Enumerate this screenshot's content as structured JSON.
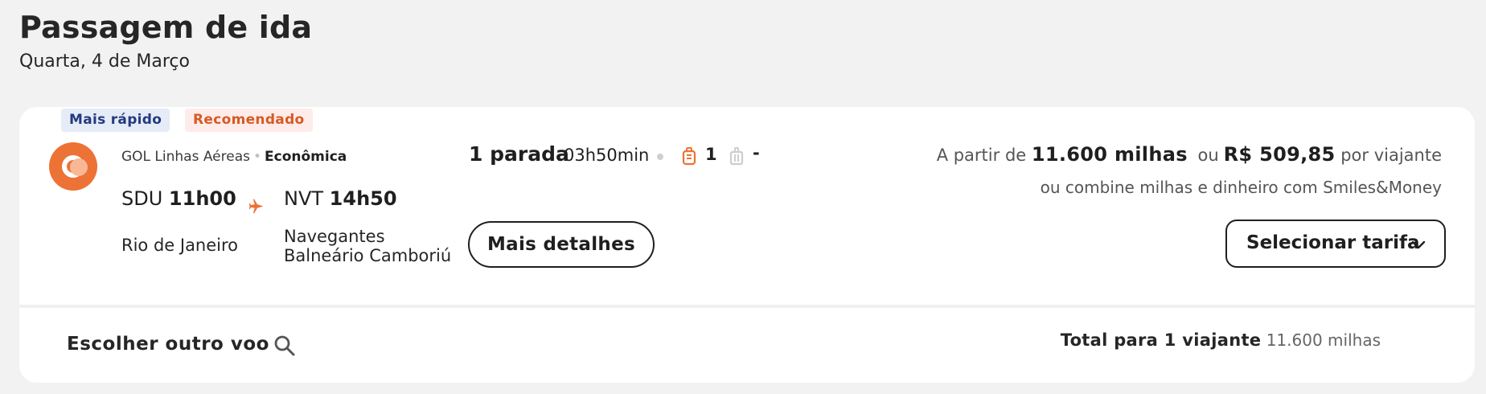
{
  "header": {
    "title": "Passagem de ida",
    "date": "Quarta, 4 de Março"
  },
  "badges": {
    "fastest": "Mais rápido",
    "recommended": "Recomendado"
  },
  "flight": {
    "airline": "GOL Linhas Aéreas",
    "cabin": "Econômica",
    "departure": {
      "code": "SDU",
      "time": "11h00",
      "city": "Rio de Janeiro"
    },
    "arrival": {
      "code": "NVT",
      "time": "14h50",
      "city": "Navegantes Balneário Camboriú"
    },
    "stops": "1 parada",
    "duration": "03h50min",
    "bags_count": "1",
    "trolley_count": "-"
  },
  "price": {
    "prefix": "A partir de",
    "miles": "11.600 milhas",
    "or": "ou",
    "cash": "R$ 509,85",
    "suffix": "por viajante",
    "combine_text": "ou combine milhas e dinheiro com Smiles&Money"
  },
  "buttons": {
    "details": "Mais detalhes",
    "select_fare": "Selecionar tarifa",
    "other_flight": "Escolher outro voo"
  },
  "total": {
    "label": "Total para 1 viajante",
    "value": "11.600 milhas"
  },
  "colors": {
    "accent_orange": "#ec7235",
    "badge_fast_text": "#233a7e",
    "badge_rec_text": "#d75a24"
  },
  "icons": [
    "gol-logo-icon",
    "airplane-icon",
    "bag-icon",
    "trolley-icon",
    "chevron-down-icon",
    "search-icon"
  ]
}
